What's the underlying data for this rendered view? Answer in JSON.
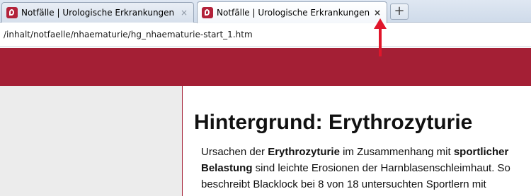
{
  "tabs": [
    {
      "title": "Notfälle | Urologische Erkrankungen ...",
      "close_glyph": "×",
      "active": false
    },
    {
      "title": "Notfälle | Urologische Erkrankungen ...",
      "close_glyph": "×",
      "active": true
    }
  ],
  "new_tab_glyph": "+",
  "address_bar": {
    "url": "/inhalt/notfaelle/nhaematurie/hg_nhaematurie-start_1.htm"
  },
  "article": {
    "heading": "Hintergrund: Erythrozyturie",
    "line1": {
      "a": "Ursachen der ",
      "b": "Erythrozyturie",
      "c": " im Zusammenhang mit ",
      "d": "sportlicher"
    },
    "line2": {
      "a": "Belastung",
      "b": " sind leichte Erosionen der Harnblasenschleimhaut. So"
    },
    "line3": "beschreibt Blacklock bei 8 von 18 untersuchten Sportlern mit"
  },
  "colors": {
    "brand": "#a41f35",
    "annotation_arrow": "#e0162b"
  }
}
